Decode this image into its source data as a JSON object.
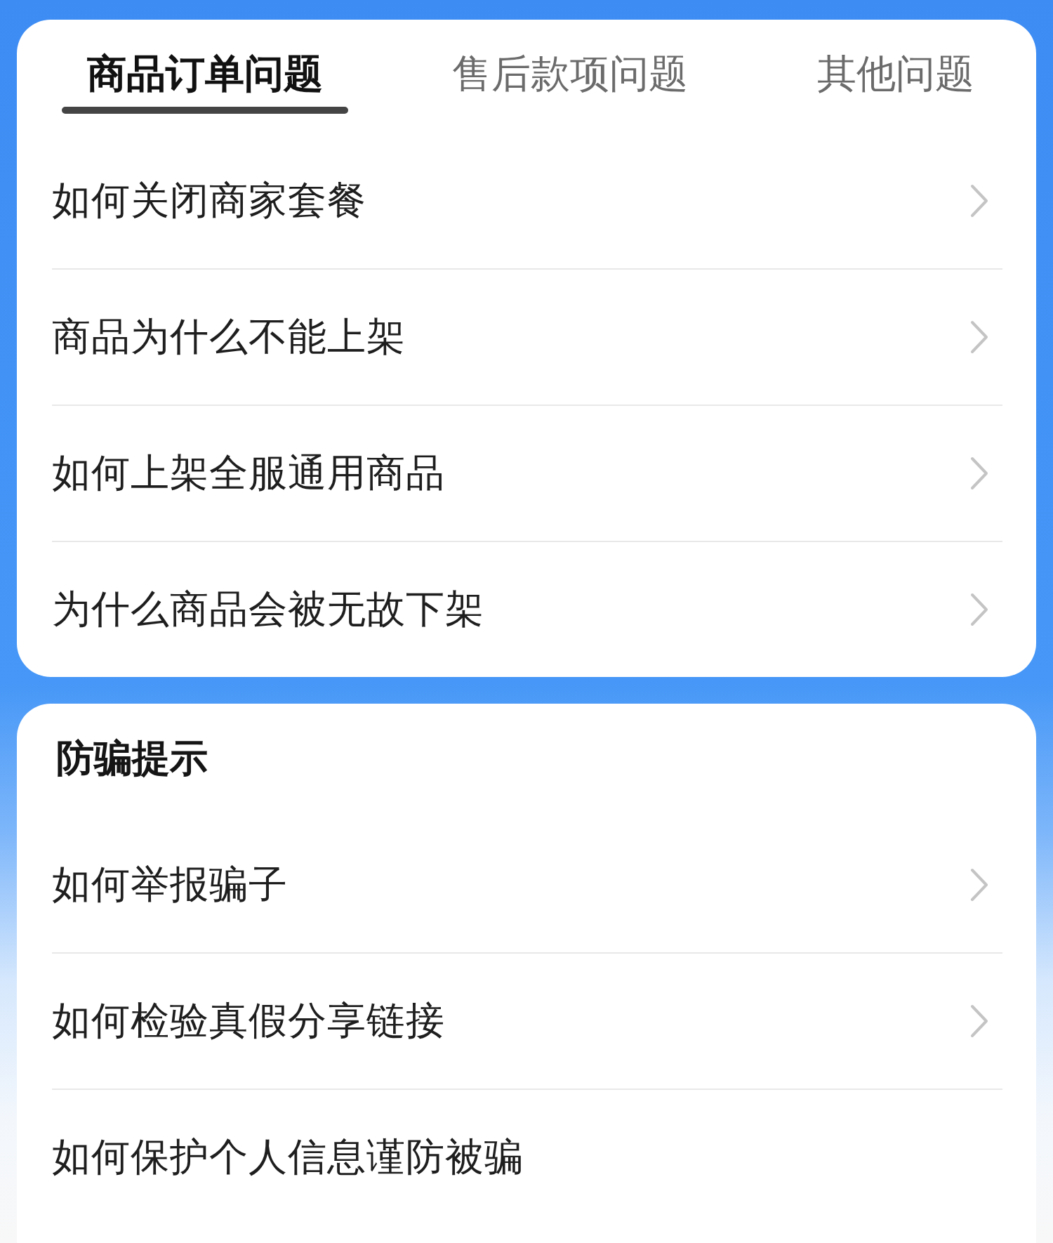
{
  "tabs": [
    {
      "label": "商品订单问题",
      "selected": true
    },
    {
      "label": "售后款项问题",
      "selected": false
    },
    {
      "label": "其他问题",
      "selected": false
    }
  ],
  "order_questions": [
    {
      "label": "如何关闭商家套餐",
      "chevron": true
    },
    {
      "label": "商品为什么不能上架",
      "chevron": true
    },
    {
      "label": "如何上架全服通用商品",
      "chevron": true
    },
    {
      "label": "为什么商品会被无故下架",
      "chevron": true
    }
  ],
  "fraud_tips": {
    "title": "防骗提示",
    "items": [
      {
        "label": "如何举报骗子",
        "chevron": true
      },
      {
        "label": "如何检验真假分享链接",
        "chevron": true
      },
      {
        "label": "如何保护个人信息谨防被骗",
        "chevron": false
      }
    ]
  }
}
